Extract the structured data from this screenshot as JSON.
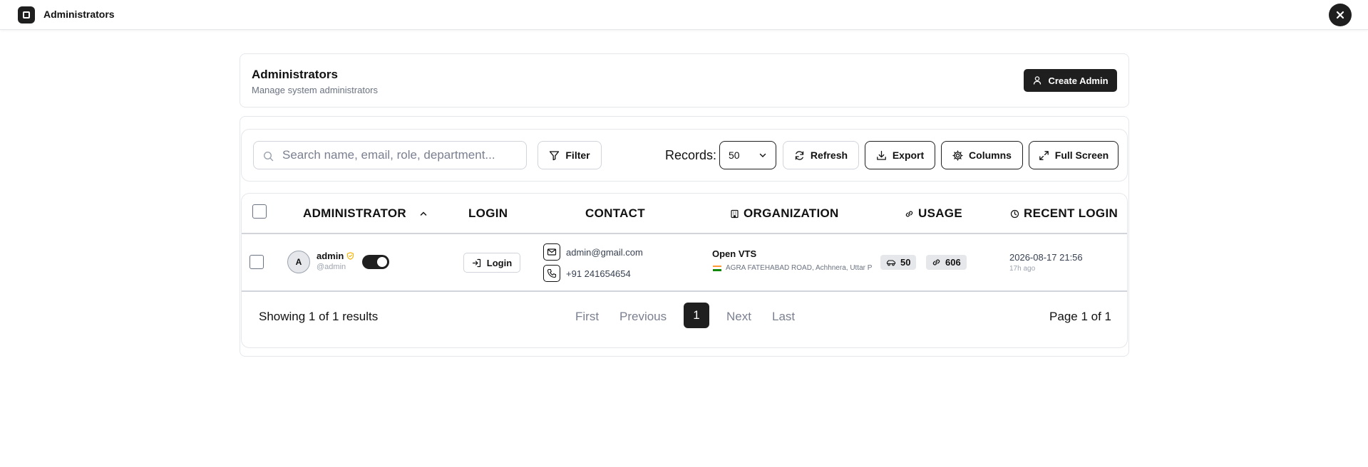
{
  "topbar": {
    "title": "Administrators",
    "close_icon": "close-icon"
  },
  "header": {
    "title": "Administrators",
    "subtitle": "Manage system administrators",
    "create_button": "Create Admin"
  },
  "toolbar": {
    "search_placeholder": "Search name, email, role, department...",
    "search_value": "",
    "filter_label": "Filter",
    "records_label": "Records:",
    "records_value": "50",
    "refresh_label": "Refresh",
    "export_label": "Export",
    "columns_label": "Columns",
    "fullscreen_label": "Full Screen"
  },
  "table": {
    "columns": [
      "ADMINISTRATOR",
      "LOGIN",
      "CONTACT",
      "ORGANIZATION",
      "USAGE",
      "RECENT LOGIN"
    ],
    "rows": [
      {
        "avatar_letter": "A",
        "name": "admin",
        "handle": "@admin",
        "active": true,
        "login_label": "Login",
        "email": "admin@gmail.com",
        "phone": "+91 241654654",
        "org_name": "Open VTS",
        "org_address": "AGRA FATEHABAD ROAD, Achhnera, Uttar P",
        "usage_vehicles": "50",
        "usage_links": "606",
        "recent_time": "2026-08-17 21:56",
        "recent_ago": "17h ago"
      }
    ]
  },
  "pagination": {
    "summary": "Showing 1 of 1 results",
    "first": "First",
    "previous": "Previous",
    "current": "1",
    "next": "Next",
    "last": "Last",
    "page_of": "Page 1 of 1"
  },
  "colors": {
    "accent": "#1f1f1f",
    "verified": "#f5b301",
    "border": "#e5e7eb"
  }
}
